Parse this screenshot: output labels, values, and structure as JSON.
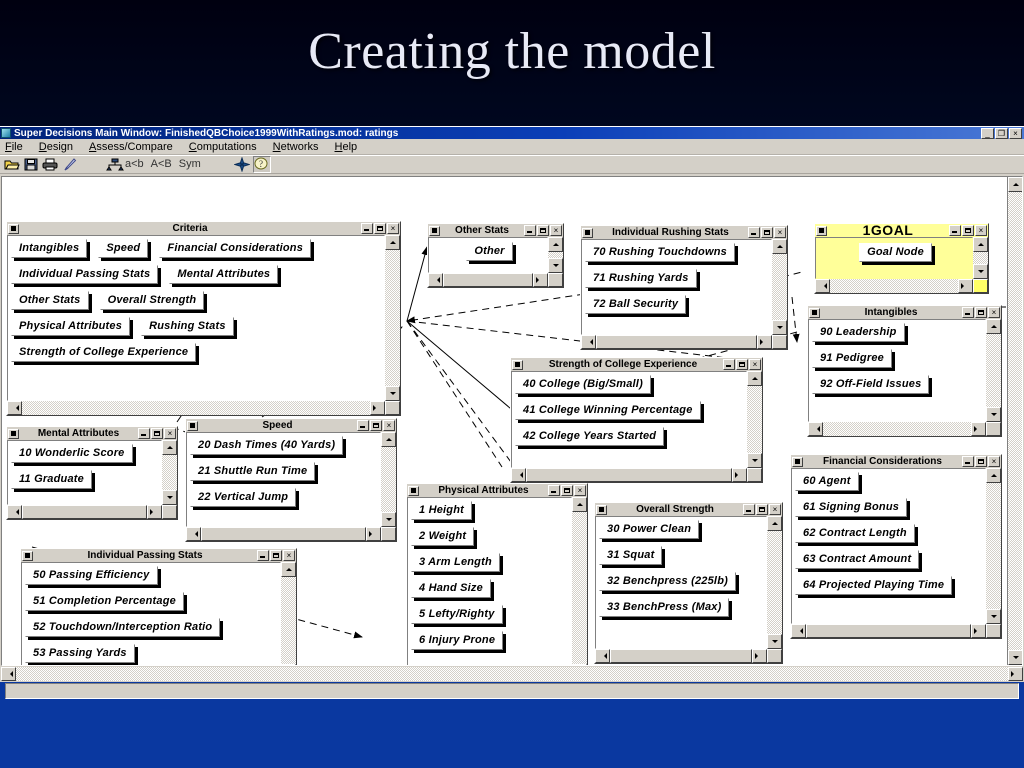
{
  "slide": {
    "title": "Creating the model"
  },
  "window": {
    "title": "Super Decisions Main Window: FinishedQBChoice1999WithRatings.mod: ratings",
    "app_icon": "super-decisions-icon",
    "buttons": {
      "minimize": "_",
      "restore": "❐",
      "close": "×"
    }
  },
  "menubar": {
    "items": [
      "File",
      "Design",
      "Assess/Compare",
      "Computations",
      "Networks",
      "Help"
    ]
  },
  "toolbar": {
    "icons": [
      "open-folder-icon",
      "save-icon",
      "print-icon",
      "edit-pencil-icon",
      "hierarchy-icon",
      "node-star-icon",
      "help-question-icon"
    ],
    "labels": [
      "a<b",
      "A<B",
      "Sym"
    ]
  },
  "clusters": [
    {
      "id": "criteria",
      "title": "Criteria",
      "nodes": [
        "Intangibles",
        "Speed",
        "Financial Considerations",
        "Individual Passing Stats",
        "Mental Attributes",
        "Other Stats",
        "Overall Strength",
        "Physical Attributes",
        "Rushing Stats",
        "Strength of College Experience"
      ]
    },
    {
      "id": "other-stats",
      "title": "Other Stats",
      "nodes": [
        "Other"
      ]
    },
    {
      "id": "individual-rushing-stats",
      "title": "Individual Rushing Stats",
      "nodes": [
        "70 Rushing Touchdowns",
        "71 Rushing Yards",
        "72 Ball Security"
      ]
    },
    {
      "id": "goal",
      "title": "1GOAL",
      "nodes": [
        "Goal Node"
      ],
      "accent": "#ffff99"
    },
    {
      "id": "intangibles",
      "title": "Intangibles",
      "nodes": [
        "90 Leadership",
        "91 Pedigree",
        "92 Off-Field Issues"
      ]
    },
    {
      "id": "strength-of-college-experience",
      "title": "Strength of College Experience",
      "nodes": [
        "40 College (Big/Small)",
        "41 College Winning Percentage",
        "42 College Years Started"
      ]
    },
    {
      "id": "mental-attributes",
      "title": "Mental Attributes",
      "nodes": [
        "10 Wonderlic Score",
        "11 Graduate"
      ]
    },
    {
      "id": "speed",
      "title": "Speed",
      "nodes": [
        "20 Dash Times (40 Yards)",
        "21 Shuttle Run Time",
        "22 Vertical Jump"
      ]
    },
    {
      "id": "financial-considerations",
      "title": "Financial Considerations",
      "nodes": [
        "60 Agent",
        "61 Signing Bonus",
        "62 Contract Length",
        "63 Contract Amount",
        "64 Projected Playing Time"
      ]
    },
    {
      "id": "physical-attributes",
      "title": "Physical Attributes",
      "nodes": [
        "1 Height",
        "2 Weight",
        "3 Arm Length",
        "4 Hand Size",
        "5  Lefty/Righty",
        "6 Injury Prone"
      ]
    },
    {
      "id": "overall-strength",
      "title": "Overall Strength",
      "nodes": [
        "30 Power Clean",
        "31 Squat",
        "32 Benchpress (225lb)",
        "33 BenchPress (Max)"
      ]
    },
    {
      "id": "individual-passing-stats",
      "title": "Individual Passing Stats",
      "nodes": [
        "50 Passing Efficiency",
        "51 Completion Percentage",
        "52 Touchdown/Interception Ratio",
        "53 Passing Yards"
      ]
    }
  ],
  "statusbar": {
    "text": ""
  }
}
